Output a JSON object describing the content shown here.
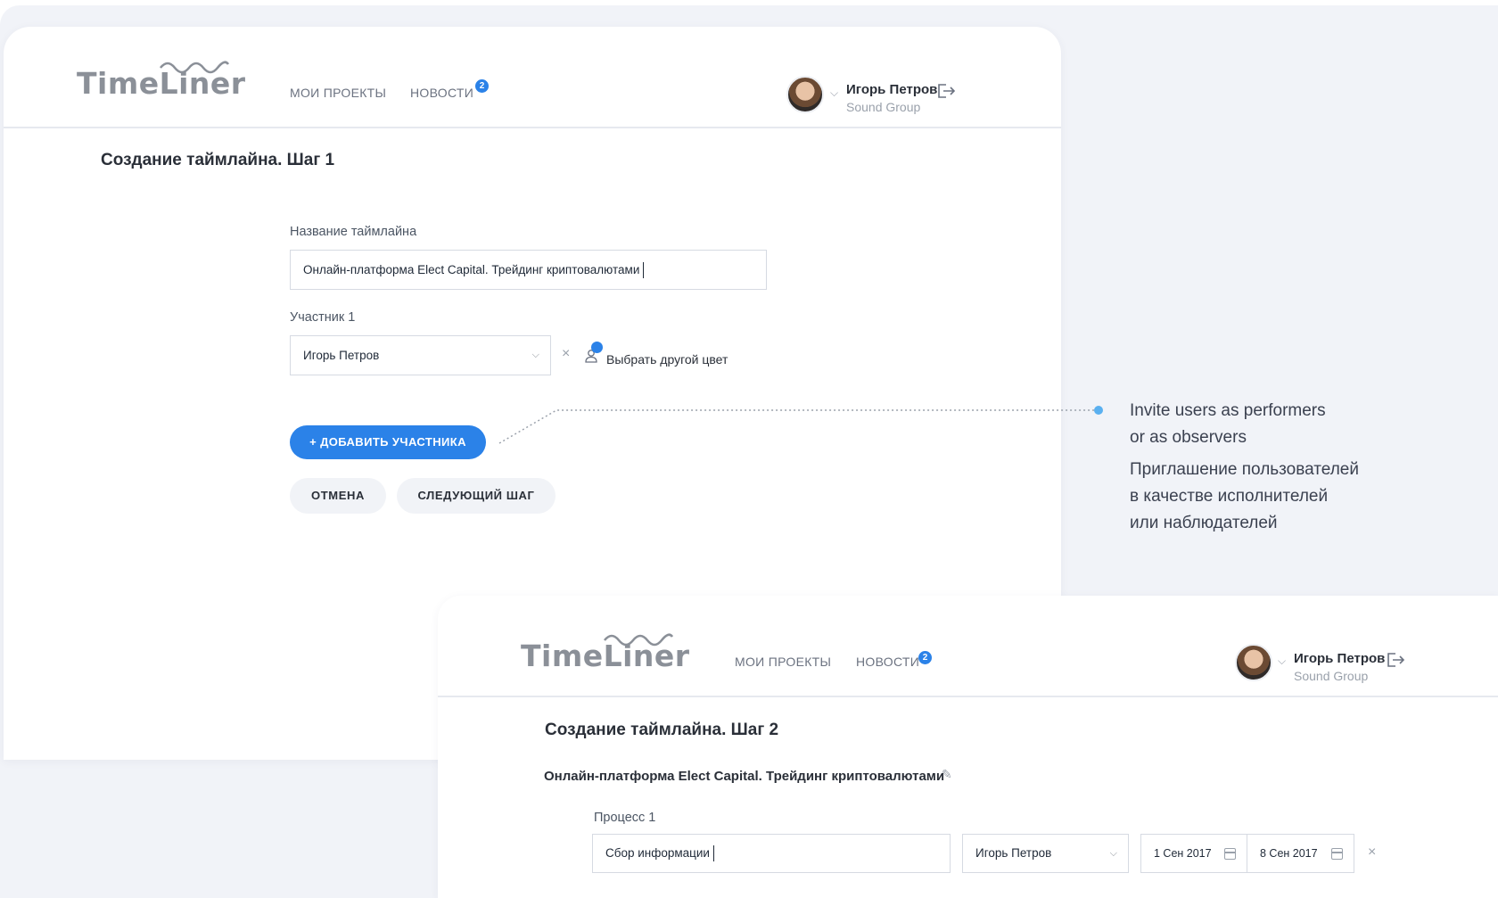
{
  "app": {
    "logo": "TimeLiner",
    "nav": {
      "projects": "МОИ ПРОЕКТЫ",
      "news": "НОВОСТИ",
      "news_badge": "2"
    },
    "user": {
      "name": "Игорь Петров",
      "org": "Sound Group"
    }
  },
  "step1": {
    "title": "Создание таймлайна. Шаг 1",
    "timeline_name_label": "Название таймлайна",
    "timeline_name_value": "Онлайн-платформа Elect Capital. Трейдинг криптовалютами",
    "participant_label": "Участник 1",
    "participant_value": "Игорь Петров",
    "choose_color": "Выбрать другой цвет",
    "add_participant": "+ ДОБАВИТЬ УЧАСТНИКА",
    "cancel": "ОТМЕНА",
    "next_step": "СЛЕДУЮЩИЙ ШАГ"
  },
  "annotation": {
    "en_line1": "Invite users as performers",
    "en_line2": "or as observers",
    "ru_line1": "Приглашение пользователей",
    "ru_line2": "в качестве исполнителей",
    "ru_line3": "или наблюдателей"
  },
  "step2": {
    "title": "Создание таймлайна. Шаг 2",
    "timeline_name": "Онлайн-платформа Elect Capital. Трейдинг криптовалютами",
    "process_label": "Процесс 1",
    "process_value": "Сбор информации",
    "assignee": "Игорь Петров",
    "date_start": "1 Сен 2017",
    "date_end": "8 Сен 2017"
  },
  "colors": {
    "accent": "#2b82e8",
    "background": "#f1f3f8"
  }
}
